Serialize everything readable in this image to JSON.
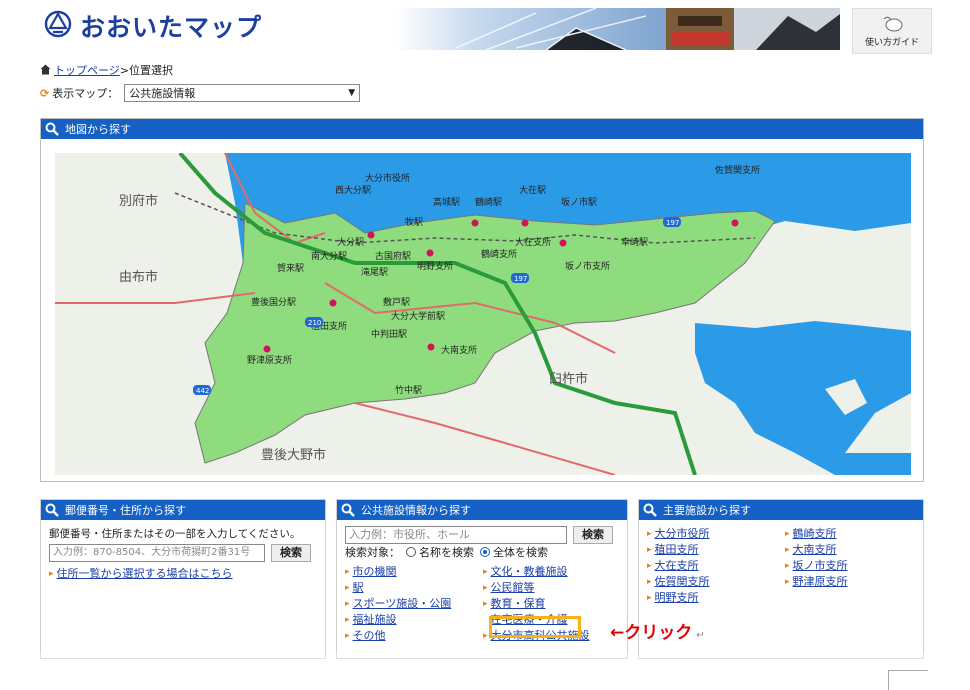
{
  "header": {
    "logo_text": "おおいたマップ",
    "guide_label": "使い方ガイド"
  },
  "breadcrumb": {
    "home_label": "トップページ",
    "separator": ">",
    "current": "位置選択"
  },
  "map_selector": {
    "label": "表示マップ：",
    "selected": "公共施設情報"
  },
  "map_panel": {
    "title": "地図から探す",
    "city_labels": [
      "別府市",
      "由布市",
      "臼杵市",
      "豊後大野市"
    ],
    "station_labels": [
      "大分市役所",
      "西大分駅",
      "大分駅",
      "南大分駅",
      "古国府駅",
      "牧駅",
      "高城駅",
      "鶴崎駅",
      "大在駅",
      "坂ノ市駅",
      "幸崎駅",
      "佐賀関支所",
      "明野支所",
      "鶴崎支所",
      "大在支所",
      "坂ノ市支所",
      "賀来駅",
      "滝尾駅",
      "豊後国分駅",
      "敷戸駅",
      "大分大学前駅",
      "中判田駅",
      "植田支所",
      "大南支所",
      "野津原支所",
      "竹中駅"
    ],
    "route_numbers": [
      "197",
      "197",
      "210",
      "442"
    ]
  },
  "postal_panel": {
    "title": "郵便番号・住所から探す",
    "instruction": "郵便番号・住所またはその一部を入力してください。",
    "placeholder": "入力例：870-8504、大分市荷揚町2番31号",
    "search_label": "検索",
    "list_link": "住所一覧から選択する場合はこちら"
  },
  "facility_panel": {
    "title": "公共施設情報から探す",
    "placeholder": "入力例：市役所、ホール",
    "search_label": "検索",
    "target_label": "検索対象：",
    "radio_name": "名称を検索",
    "radio_all": "全体を検索",
    "links_left": [
      "市の機関",
      "駅",
      "スポーツ施設・公園",
      "福祉施設",
      "その他"
    ],
    "links_right": [
      "文化・教養施設",
      "公民館等",
      "教育・保育",
      "在宅医療・介護",
      "大分市高科公共施設"
    ]
  },
  "main_panel": {
    "title": "主要施設から探す",
    "links_left": [
      "大分市役所",
      "稙田支所",
      "大在支所",
      "佐賀関支所",
      "明野支所"
    ],
    "links_right": [
      "鶴崎支所",
      "大南支所",
      "坂ノ市支所",
      "野津原支所"
    ]
  },
  "annotation": {
    "click_note": "←クリック",
    "return_mark": "↵"
  },
  "colors": {
    "brand_blue": "#1e3f9e",
    "panel_bar": "#1560c4",
    "highlight": "#f5b21a",
    "click_note": "#e00000",
    "sea": "#2b9be8",
    "city_area": "#8fdc7e",
    "link": "#1a3fa8"
  }
}
